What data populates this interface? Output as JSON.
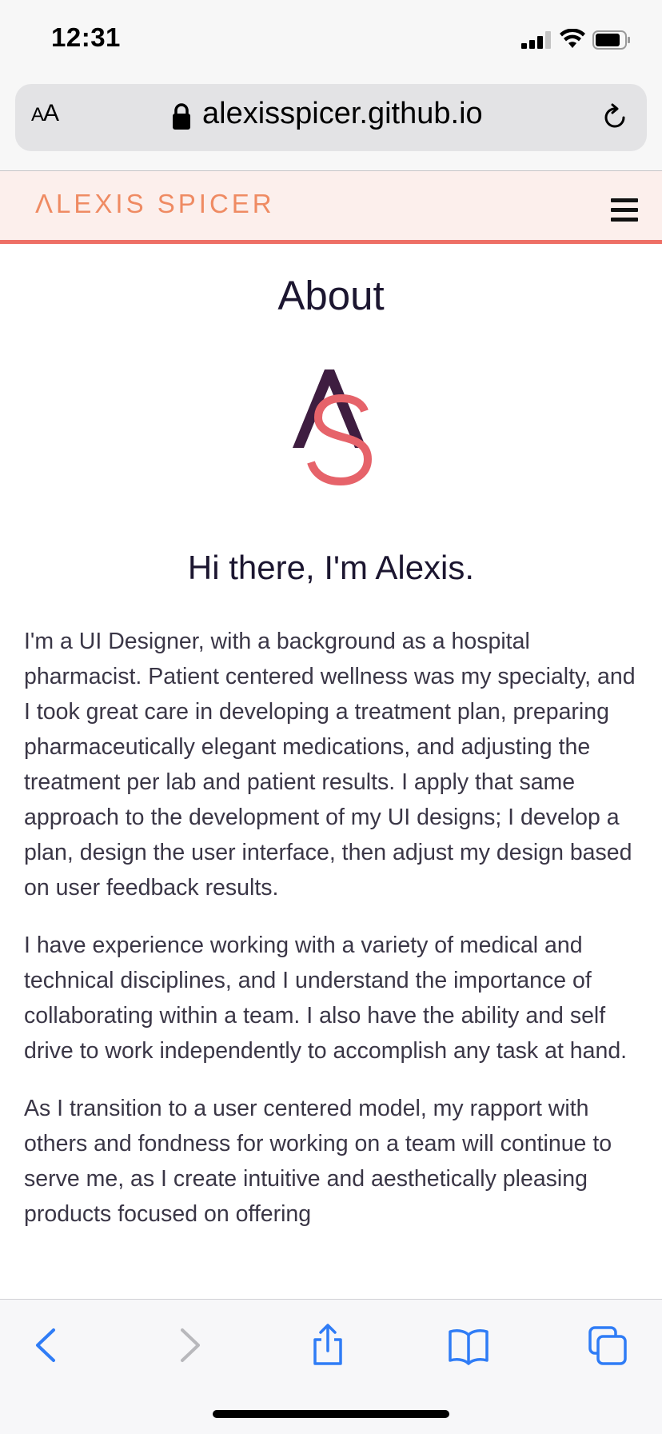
{
  "status_bar": {
    "time": "12:31"
  },
  "browser": {
    "text_size_button": {
      "small": "A",
      "large": "A"
    },
    "url": "alexisspicer.github.io"
  },
  "site": {
    "logo_text": "ΛLEXIS SPICER",
    "accent_color": "#ee6f66"
  },
  "main": {
    "title": "About",
    "heading": "Hi there, I'm Alexis.",
    "paragraphs": [
      "I'm a UI Designer, with a background as a hospital pharmacist. Patient centered wellness was my specialty, and I took great care in developing a treatment plan, preparing pharmaceutically elegant medications, and adjusting the treatment per lab and patient results. I apply that same approach to the development of my UI designs; I develop a plan, design the user interface, then adjust my design based on user feedback results.",
      "I have experience working with a variety of medical and technical disciplines, and I understand the importance of collaborating within a team. I also have the ability and self drive to work independently to accomplish any task at hand.",
      "As I transition to a user centered model, my rapport with others and fondness for working on a team will continue to serve me, as I create intuitive and aesthetically pleasing products focused on offering"
    ]
  },
  "toolbar": {
    "icons": [
      "back-icon",
      "forward-icon",
      "share-icon",
      "bookmarks-icon",
      "tabs-icon"
    ]
  }
}
